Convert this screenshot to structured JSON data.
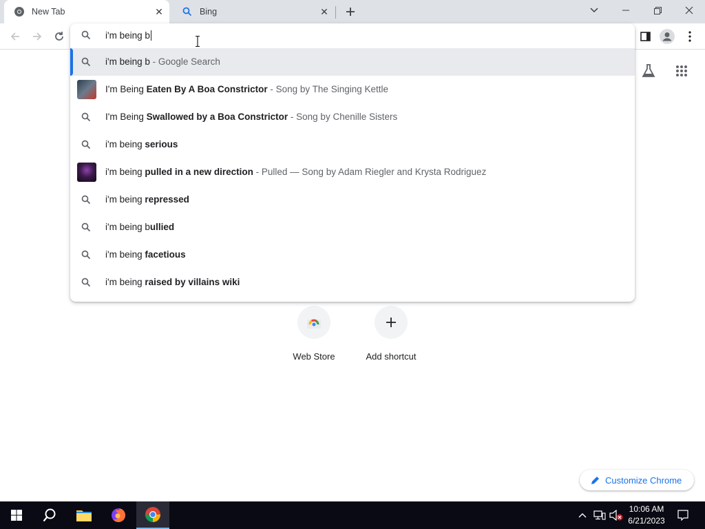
{
  "tabs": [
    {
      "title": "New Tab",
      "icon": "chrome-icon",
      "active": true
    },
    {
      "title": "Bing",
      "icon": "search-icon",
      "active": false
    }
  ],
  "omnibox": {
    "query": "i'm being b",
    "suggestions": [
      {
        "type": "search",
        "prefix": "i'm being b",
        "bold": "",
        "desc": " - Google Search",
        "selected": true
      },
      {
        "type": "entity",
        "prefix": "I'm Being ",
        "bold": "Eaten By A Boa Constrictor",
        "desc": " - Song by The Singing Kettle"
      },
      {
        "type": "search",
        "prefix": "I'm Being ",
        "bold": "Swallowed by a Boa Constrictor",
        "desc": " - Song by Chenille Sisters"
      },
      {
        "type": "search",
        "prefix": "i'm being ",
        "bold": "serious",
        "desc": ""
      },
      {
        "type": "entity",
        "prefix": "i'm being ",
        "bold": "pulled in a new direction",
        "desc": " - Pulled — Song by Adam Riegler and Krysta Rodriguez"
      },
      {
        "type": "search",
        "prefix": "i'm being ",
        "bold": "repressed",
        "desc": ""
      },
      {
        "type": "search",
        "prefix": "i'm being b",
        "bold": "ullied",
        "desc": ""
      },
      {
        "type": "search",
        "prefix": "i'm being ",
        "bold": "facetious",
        "desc": ""
      },
      {
        "type": "search",
        "prefix": "i'm being ",
        "bold": "raised by villains wiki",
        "desc": ""
      }
    ]
  },
  "shortcuts": [
    {
      "label": "Web Store",
      "icon": "webstore-icon"
    },
    {
      "label": "Add shortcut",
      "icon": "plus-icon"
    }
  ],
  "customize_label": "Customize Chrome",
  "taskbar": {
    "time": "10:06 AM",
    "date": "6/21/2023"
  },
  "colors": {
    "accent": "#1a73e8",
    "tabstrip": "#dee1e6",
    "taskbar": "#0a0a14"
  }
}
